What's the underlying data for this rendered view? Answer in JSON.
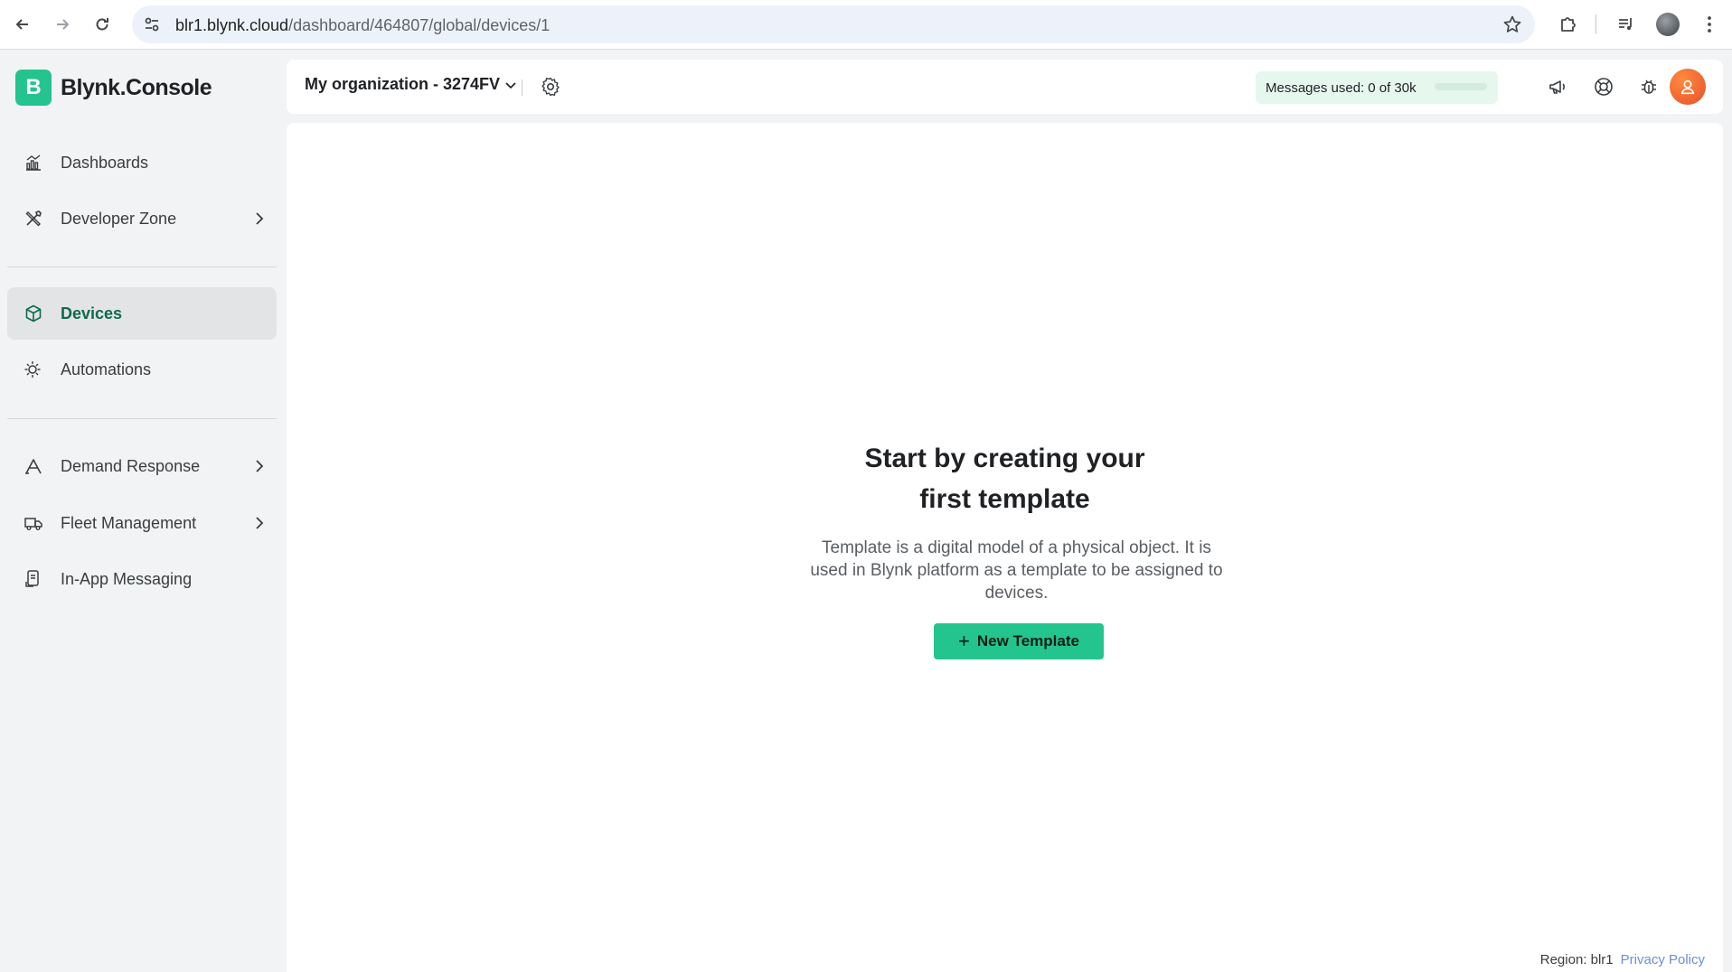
{
  "browser": {
    "url_host": "blr1.blynk.cloud",
    "url_path": "/dashboard/464807/global/devices/1"
  },
  "brand": {
    "logo_letter": "B",
    "name": "Blynk.Console",
    "color": "#23c48e"
  },
  "sidebar": {
    "items": [
      {
        "label": "Dashboards",
        "icon": "chart-icon",
        "active": false,
        "has_chevron": false
      },
      {
        "label": "Developer Zone",
        "icon": "tools-icon",
        "active": false,
        "has_chevron": true
      },
      {
        "label": "Devices",
        "icon": "cube-icon",
        "active": true,
        "has_chevron": false
      },
      {
        "label": "Automations",
        "icon": "automation-icon",
        "active": false,
        "has_chevron": false
      },
      {
        "label": "Demand Response",
        "icon": "demand-response-icon",
        "active": false,
        "has_chevron": true
      },
      {
        "label": "Fleet Management",
        "icon": "truck-icon",
        "active": false,
        "has_chevron": true
      },
      {
        "label": "In-App Messaging",
        "icon": "messaging-icon",
        "active": false,
        "has_chevron": false
      }
    ]
  },
  "topbar": {
    "organization": "My organization - 3274FV",
    "messages_label": "Messages used:",
    "messages_value": "0 of 30k",
    "messages_used_fraction": 0
  },
  "empty_state": {
    "title_line1": "Start by creating your",
    "title_line2": "first template",
    "description": "Template is a digital model of a physical object. It is used in Blynk platform as a template to be assigned to devices.",
    "button_label": "New Template"
  },
  "footer": {
    "region": "Region: blr1",
    "privacy": "Privacy Policy"
  }
}
